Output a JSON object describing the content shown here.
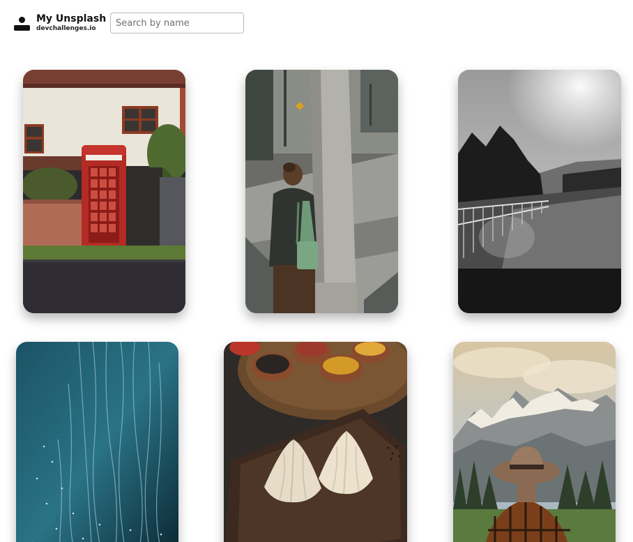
{
  "header": {
    "title": "My Unsplash",
    "subtitle": "devchallenges.io",
    "logo_icon": "user-icon"
  },
  "search": {
    "placeholder": "Search by name",
    "value": ""
  },
  "gallery": {
    "photos": [
      {
        "subject": "red-telephone-box"
      },
      {
        "subject": "woman-with-tote-bag-by-pillar"
      },
      {
        "subject": "foggy-railing-landscape"
      },
      {
        "subject": "teal-light-streaks"
      },
      {
        "subject": "dumplings-and-spices"
      },
      {
        "subject": "hiker-with-hat-and-mountains"
      }
    ]
  }
}
